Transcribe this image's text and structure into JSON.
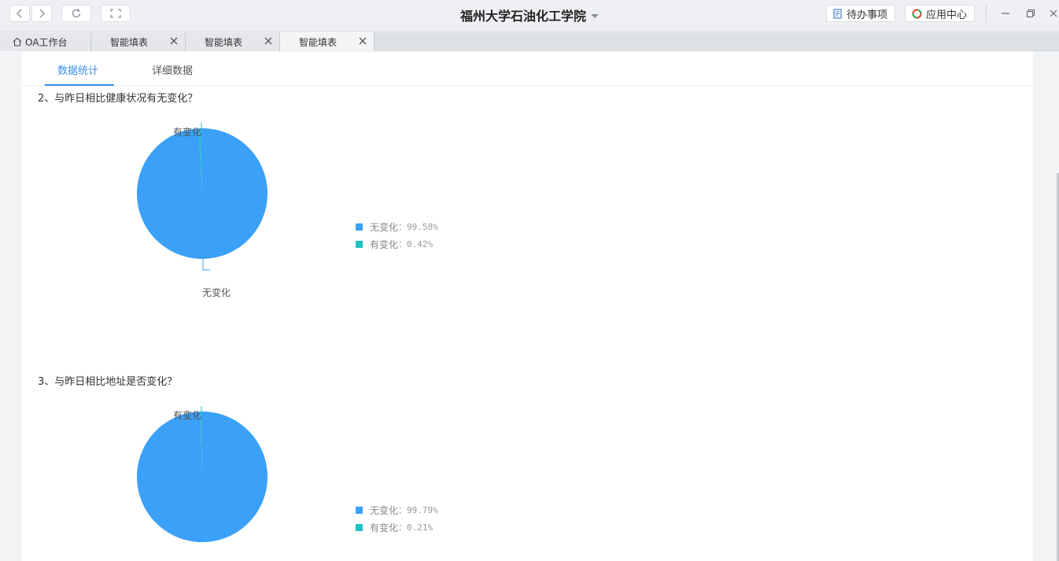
{
  "window": {
    "title": "福州大学石油化工学院",
    "todo_label": "待办事项",
    "appcenter_label": "应用中心"
  },
  "tabs": [
    {
      "label": "OA工作台"
    },
    {
      "label": "智能填表"
    },
    {
      "label": "智能填表"
    },
    {
      "label": "智能填表"
    }
  ],
  "subtabs": [
    {
      "label": "数据统计"
    },
    {
      "label": "详细数据"
    }
  ],
  "colors": {
    "series_no_change": "#3aa0f8",
    "series_changed": "#21bfc4",
    "accent": "#3a8ee6"
  },
  "questions": [
    {
      "title": "2、与昨日相比健康状况有无变化？",
      "top_label": "有变化",
      "bottom_label": "无变化",
      "legend": [
        {
          "name": "无变化",
          "value_text": "：99.58%"
        },
        {
          "name": "有变化",
          "value_text": "：0.42%"
        }
      ]
    },
    {
      "title": "3、与昨日相比地址是否变化？",
      "top_label": "有变化",
      "legend": [
        {
          "name": "无变化",
          "value_text": "：99.79%"
        },
        {
          "name": "有变化",
          "value_text": "：0.21%"
        }
      ]
    }
  ],
  "chart_data": [
    {
      "type": "pie",
      "title": "2、与昨日相比健康状况有无变化？",
      "categories": [
        "无变化",
        "有变化"
      ],
      "values": [
        99.58,
        0.42
      ],
      "legend_position": "right"
    },
    {
      "type": "pie",
      "title": "3、与昨日相比地址是否变化？",
      "categories": [
        "无变化",
        "有变化"
      ],
      "values": [
        99.79,
        0.21
      ],
      "legend_position": "right"
    }
  ]
}
